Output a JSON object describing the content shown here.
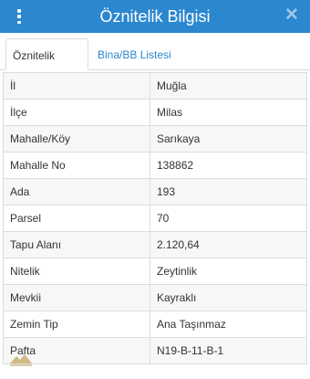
{
  "header": {
    "title": "Öznitelik Bilgisi",
    "menu_icon": "vertical-dots-icon",
    "close_icon": "close-icon"
  },
  "tabs": [
    {
      "label": "Öznitelik Bilgisi",
      "active": true
    },
    {
      "label": "Bina/BB Listesi",
      "active": false
    }
  ],
  "attributes": [
    {
      "key": "İl",
      "value": "Muğla"
    },
    {
      "key": "İlçe",
      "value": "Milas"
    },
    {
      "key": "Mahalle/Köy",
      "value": "Sarıkaya"
    },
    {
      "key": "Mahalle No",
      "value": "138862"
    },
    {
      "key": "Ada",
      "value": "193"
    },
    {
      "key": "Parsel",
      "value": "70"
    },
    {
      "key": "Tapu Alanı",
      "value": "2.120,64"
    },
    {
      "key": "Nitelik",
      "value": "Zeytinlik"
    },
    {
      "key": "Mevkii",
      "value": "Kayraklı"
    },
    {
      "key": "Zemin Tip",
      "value": "Ana Taşınmaz"
    },
    {
      "key": "Pafta",
      "value": "N19-B-11-B-1"
    }
  ],
  "colors": {
    "accent": "#2b87ce",
    "row_alt": "#f7f7f7",
    "border": "#dcdcdc"
  }
}
